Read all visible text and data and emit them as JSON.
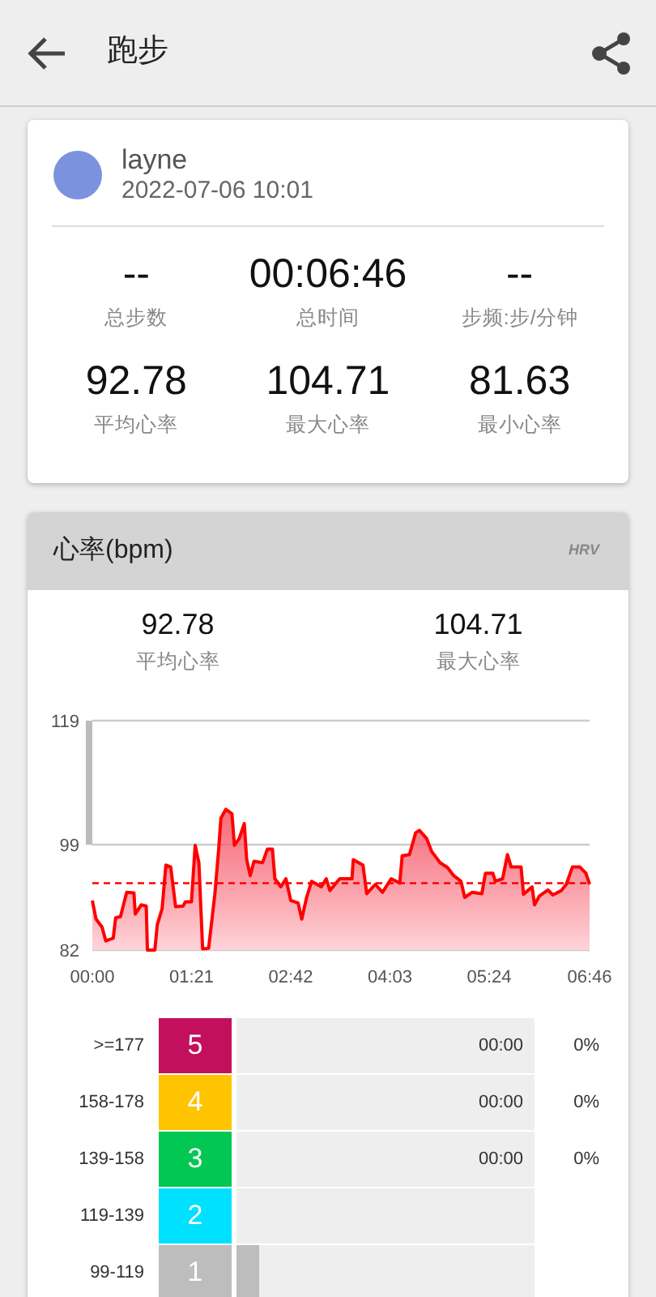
{
  "app_bar": {
    "title": "跑步"
  },
  "summary": {
    "name": "layne",
    "timestamp": "2022-07-06 10:01",
    "stats": [
      {
        "value": "--",
        "label": "总步数"
      },
      {
        "value": "00:06:46",
        "label": "总时间"
      },
      {
        "value": "--",
        "label": "步频:步/分钟"
      },
      {
        "value": "92.78",
        "label": "平均心率"
      },
      {
        "value": "104.71",
        "label": "最大心率"
      },
      {
        "value": "81.63",
        "label": "最小心率"
      }
    ]
  },
  "heart_rate": {
    "title": "心率(bpm)",
    "badge": "HRV",
    "stats": [
      {
        "value": "92.78",
        "label": "平均心率"
      },
      {
        "value": "104.71",
        "label": "最大心率"
      }
    ],
    "chart_data": {
      "type": "area",
      "xlim": [
        0,
        406
      ],
      "ylim": [
        82,
        119
      ],
      "xticks": [
        {
          "value": 0,
          "label": "00:00"
        },
        {
          "value": 81,
          "label": "01:21"
        },
        {
          "value": 162,
          "label": "02:42"
        },
        {
          "value": 243,
          "label": "04:03"
        },
        {
          "value": 324,
          "label": "05:24"
        },
        {
          "value": 406,
          "label": "06:46"
        }
      ],
      "yticks": [
        82,
        99,
        119
      ],
      "x": [
        0,
        3,
        8,
        11,
        17,
        19,
        23,
        28,
        34,
        35,
        40,
        44,
        45,
        51,
        53,
        57,
        60,
        64,
        68,
        74,
        76,
        81,
        84,
        87,
        90,
        95,
        100,
        103,
        105,
        109,
        114,
        116,
        120,
        124,
        126,
        129,
        132,
        139,
        143,
        147,
        149,
        154,
        158,
        162,
        168,
        171,
        175,
        179,
        187,
        191,
        194,
        202,
        212,
        213,
        221,
        224,
        231,
        237,
        244,
        251,
        253,
        259,
        264,
        267,
        273,
        277,
        284,
        290,
        295,
        301,
        304,
        310,
        318,
        321,
        327,
        329,
        335,
        339,
        342,
        350,
        352,
        359,
        361,
        365,
        372,
        376,
        383,
        387,
        392,
        398,
        403,
        406
      ],
      "series": [
        {
          "color": "#ff0000",
          "values": [
            90.0,
            87,
            85.7,
            83.5,
            83.9,
            87.2,
            87.4,
            91.3,
            91.2,
            87.8,
            89.3,
            89.1,
            82,
            82,
            86.1,
            88.7,
            95.7,
            95.4,
            89,
            89.1,
            89.8,
            89.8,
            98.9,
            96.1,
            82.2,
            82.3,
            90.9,
            97.9,
            103.3,
            104.7,
            104,
            98.9,
            100,
            102.4,
            96.6,
            94,
            96.3,
            96.1,
            98.3,
            98.3,
            93.5,
            92.2,
            93.5,
            90,
            89.6,
            87,
            90.5,
            93.1,
            92.2,
            93.5,
            91.6,
            93.5,
            93.5,
            96.6,
            95.7,
            91.1,
            92.6,
            91.3,
            93.5,
            92.8,
            97.2,
            97.4,
            100.9,
            101.3,
            100,
            97.9,
            96.1,
            95.3,
            94,
            93.1,
            90.5,
            91.3,
            91.1,
            94.4,
            94.4,
            93.1,
            93.5,
            97.4,
            95.4,
            95.4,
            91,
            92.2,
            89.3,
            90.7,
            91.7,
            90.9,
            91.6,
            92.6,
            95.4,
            95.4,
            94.4,
            92.6
          ]
        }
      ],
      "ref_lines": [
        {
          "axis": "y",
          "value": 92.78
        }
      ]
    }
  },
  "zones": [
    {
      "range": ">=177",
      "zone": "5",
      "color": "#c2105c",
      "time": "00:00",
      "percent": "0%",
      "level": 0
    },
    {
      "range": "158-178",
      "zone": "4",
      "color": "#ffc400",
      "time": "00:00",
      "percent": "0%",
      "level": 0
    },
    {
      "range": "139-158",
      "zone": "3",
      "color": "#00c853",
      "time": "00:00",
      "percent": "0%",
      "level": 0
    },
    {
      "range": "119-139",
      "zone": "2",
      "color": "#00e0ff",
      "level": 0
    },
    {
      "range": "99-119",
      "zone": "1",
      "color": "#bdbdbd",
      "level": 0.075
    }
  ]
}
